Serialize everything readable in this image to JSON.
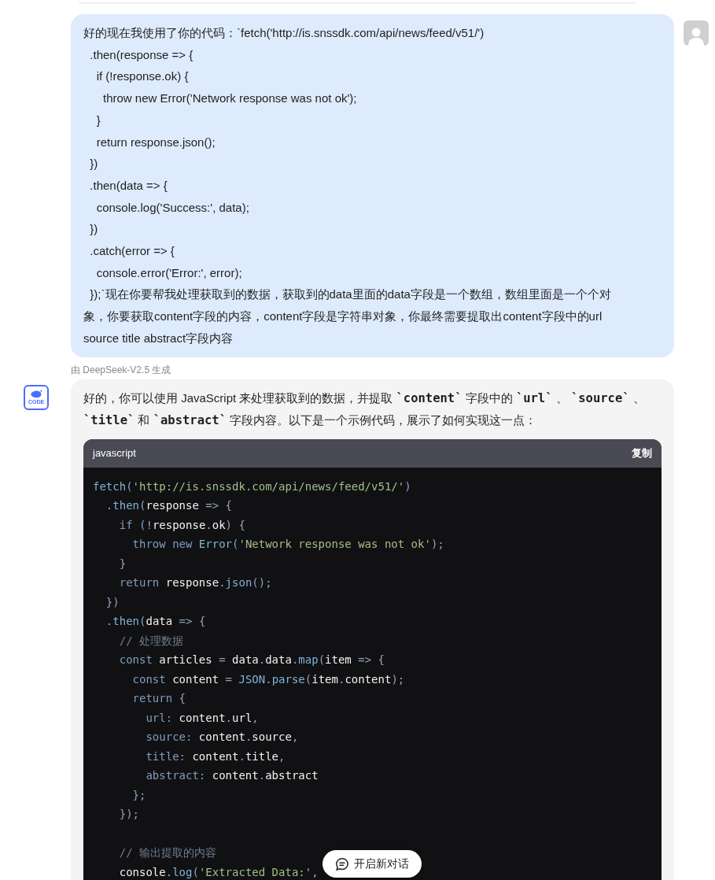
{
  "user_message": {
    "lines": [
      "好的现在我使用了你的代码：`fetch('http://is.snssdk.com/api/news/feed/v51/')",
      "  .then(response => {",
      "    if (!response.ok) {",
      "      throw new Error('Network response was not ok');",
      "    }",
      "    return response.json();",
      "  })",
      "  .then(data => {",
      "    console.log('Success:', data);",
      "  })",
      "  .catch(error => {",
      "    console.error('Error:', error);",
      "  });`现在你要帮我处理获取到的数据，获取到的data里面的data字段是一个数组，数组里面是一个个对",
      "象，你要获取content字段的内容，content字段是字符串对象，你最终需要提取出content字段中的url",
      "source title abstract字段内容"
    ]
  },
  "model_note": "由 DeepSeek-V2.5 生成",
  "assistant": {
    "avatar_label": "CODE",
    "intro": [
      {
        "kind": "text",
        "text": "好的，你可以使用 JavaScript 来处理获取到的数据，并提取 "
      },
      {
        "kind": "code",
        "text": "`content`"
      },
      {
        "kind": "text",
        "text": " 字段中的 "
      },
      {
        "kind": "code",
        "text": "`url`"
      },
      {
        "kind": "text",
        "text": " 、 "
      },
      {
        "kind": "code",
        "text": "`source`"
      },
      {
        "kind": "text",
        "text": " 、 "
      },
      {
        "kind": "code",
        "text": "`title`"
      },
      {
        "kind": "text",
        "text": " 和 "
      },
      {
        "kind": "code",
        "text": "`abstract`"
      },
      {
        "kind": "text",
        "text": " 字段内容。以下是一个示例代码，展示了如何实现这一点："
      }
    ],
    "code_block": {
      "language": "javascript",
      "copy_label": "复制",
      "lines": [
        {
          "kind": "code",
          "tokens": [
            {
              "kind": "fn",
              "text": "fetch"
            },
            {
              "kind": "op",
              "text": "("
            },
            {
              "kind": "str",
              "text": "'http://is.snssdk.com/api/news/feed/v51/'"
            },
            {
              "kind": "op",
              "text": ")"
            }
          ]
        },
        {
          "kind": "code",
          "tokens": [
            {
              "kind": "fn",
              "text": "  .then"
            },
            {
              "kind": "op",
              "text": "("
            },
            {
              "kind": "id",
              "text": "response"
            },
            {
              "kind": "op",
              "text": " => {"
            }
          ]
        },
        {
          "kind": "code",
          "tokens": [
            {
              "kind": "kw",
              "text": "    if"
            },
            {
              "kind": "op",
              "text": " (!"
            },
            {
              "kind": "id",
              "text": "response"
            },
            {
              "kind": "op",
              "text": "."
            },
            {
              "kind": "id",
              "text": "ok"
            },
            {
              "kind": "op",
              "text": ") {"
            }
          ]
        },
        {
          "kind": "code",
          "tokens": [
            {
              "kind": "kw",
              "text": "      throw new "
            },
            {
              "kind": "fn",
              "text": "Error"
            },
            {
              "kind": "op",
              "text": "("
            },
            {
              "kind": "str",
              "text": "'Network response was not ok'"
            },
            {
              "kind": "op",
              "text": ");"
            }
          ]
        },
        {
          "kind": "code",
          "tokens": [
            {
              "kind": "op",
              "text": "    }"
            }
          ]
        },
        {
          "kind": "code",
          "tokens": [
            {
              "kind": "kw",
              "text": "    return "
            },
            {
              "kind": "id",
              "text": "response"
            },
            {
              "kind": "op",
              "text": "."
            },
            {
              "kind": "fn",
              "text": "json"
            },
            {
              "kind": "op",
              "text": "();"
            }
          ]
        },
        {
          "kind": "code",
          "tokens": [
            {
              "kind": "op",
              "text": "  })"
            }
          ]
        },
        {
          "kind": "code",
          "tokens": [
            {
              "kind": "fn",
              "text": "  .then"
            },
            {
              "kind": "op",
              "text": "("
            },
            {
              "kind": "id",
              "text": "data"
            },
            {
              "kind": "op",
              "text": " => {"
            }
          ]
        },
        {
          "kind": "code",
          "tokens": [
            {
              "kind": "comment",
              "text": "    // 处理数据"
            }
          ]
        },
        {
          "kind": "code",
          "tokens": [
            {
              "kind": "kw",
              "text": "    const "
            },
            {
              "kind": "id",
              "text": "articles"
            },
            {
              "kind": "op",
              "text": " = "
            },
            {
              "kind": "id",
              "text": "data"
            },
            {
              "kind": "op",
              "text": "."
            },
            {
              "kind": "id",
              "text": "data"
            },
            {
              "kind": "op",
              "text": "."
            },
            {
              "kind": "fn",
              "text": "map"
            },
            {
              "kind": "op",
              "text": "("
            },
            {
              "kind": "id",
              "text": "item"
            },
            {
              "kind": "op",
              "text": " => {"
            }
          ]
        },
        {
          "kind": "code",
          "tokens": [
            {
              "kind": "kw",
              "text": "      const "
            },
            {
              "kind": "id",
              "text": "content"
            },
            {
              "kind": "op",
              "text": " = "
            },
            {
              "kind": "fn",
              "text": "JSON"
            },
            {
              "kind": "op",
              "text": "."
            },
            {
              "kind": "fn",
              "text": "parse"
            },
            {
              "kind": "op",
              "text": "("
            },
            {
              "kind": "id",
              "text": "item"
            },
            {
              "kind": "op",
              "text": "."
            },
            {
              "kind": "id",
              "text": "content"
            },
            {
              "kind": "op",
              "text": ");"
            }
          ]
        },
        {
          "kind": "code",
          "tokens": [
            {
              "kind": "kw",
              "text": "      return "
            },
            {
              "kind": "op",
              "text": "{"
            }
          ]
        },
        {
          "kind": "code",
          "tokens": [
            {
              "kind": "kw",
              "text": "        url: "
            },
            {
              "kind": "id",
              "text": "content"
            },
            {
              "kind": "op",
              "text": "."
            },
            {
              "kind": "id",
              "text": "url"
            },
            {
              "kind": "op",
              "text": ","
            }
          ]
        },
        {
          "kind": "code",
          "tokens": [
            {
              "kind": "kw",
              "text": "        source: "
            },
            {
              "kind": "id",
              "text": "content"
            },
            {
              "kind": "op",
              "text": "."
            },
            {
              "kind": "id",
              "text": "source"
            },
            {
              "kind": "op",
              "text": ","
            }
          ]
        },
        {
          "kind": "code",
          "tokens": [
            {
              "kind": "kw",
              "text": "        title: "
            },
            {
              "kind": "id",
              "text": "content"
            },
            {
              "kind": "op",
              "text": "."
            },
            {
              "kind": "id",
              "text": "title"
            },
            {
              "kind": "op",
              "text": ","
            }
          ]
        },
        {
          "kind": "code",
          "tokens": [
            {
              "kind": "kw",
              "text": "        abstract: "
            },
            {
              "kind": "id",
              "text": "content"
            },
            {
              "kind": "op",
              "text": "."
            },
            {
              "kind": "id",
              "text": "abstract"
            }
          ]
        },
        {
          "kind": "code",
          "tokens": [
            {
              "kind": "op",
              "text": "      };"
            }
          ]
        },
        {
          "kind": "code",
          "tokens": [
            {
              "kind": "op",
              "text": "    });"
            }
          ]
        },
        {
          "kind": "blank"
        },
        {
          "kind": "code",
          "tokens": [
            {
              "kind": "comment",
              "text": "    // 输出提取的内容"
            }
          ]
        },
        {
          "kind": "code",
          "tokens": [
            {
              "kind": "id",
              "text": "    console"
            },
            {
              "kind": "fn",
              "text": ".log"
            },
            {
              "kind": "op",
              "text": "("
            },
            {
              "kind": "str",
              "text": "'Extracted Data:'"
            },
            {
              "kind": "op",
              "text": ", "
            }
          ]
        }
      ]
    }
  },
  "new_chat_button": {
    "label": "开启新对话"
  }
}
